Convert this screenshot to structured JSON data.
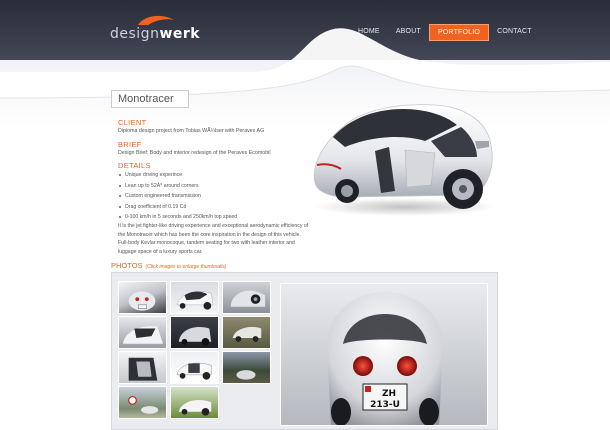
{
  "brand": {
    "logo_light": "design",
    "logo_bold": "werk"
  },
  "nav": {
    "items": [
      {
        "label": "HOME",
        "active": false
      },
      {
        "label": "ABOUT",
        "active": false
      },
      {
        "label": "PORTFOLIO",
        "active": true
      },
      {
        "label": "CONTACT",
        "active": false
      }
    ]
  },
  "project": {
    "title": "Monotracer",
    "client_head": "CLIENT",
    "client_text": "Diploma design project from Tobias WÃ¼lser with Peraves AG",
    "brief_head": "BRIEF",
    "brief_text": "Design Brief: Body and interior redesign of the Peraves Ecomobil",
    "details_head": "DETAILS",
    "details": [
      "Unique driving experince",
      "Lean up to 52Â° around corners",
      "Custom engineered transmission",
      "Drag coefficient of 0.19 Cd",
      "0-100 km/h in 5 seconds and 250km/h top speed"
    ],
    "description": [
      "It is the jet fighter-like driving experience and exceptional aerodynamic efficiency of",
      "the Monotracer which has been the core inspiration in the design of this vehicle.",
      "Full-body Kevlar monocoque, tandem seating for two with leather interior and",
      "luggage space of a luxury sports car."
    ]
  },
  "photos": {
    "heading": "PHOTOS",
    "hint": "(Click images to enlarge thumbnails)",
    "thumbnail_count": 11,
    "plate_line1": "ZH",
    "plate_line2": "213-U"
  },
  "colors": {
    "accent": "#f0621f",
    "header_dark": "#2a2d38"
  }
}
